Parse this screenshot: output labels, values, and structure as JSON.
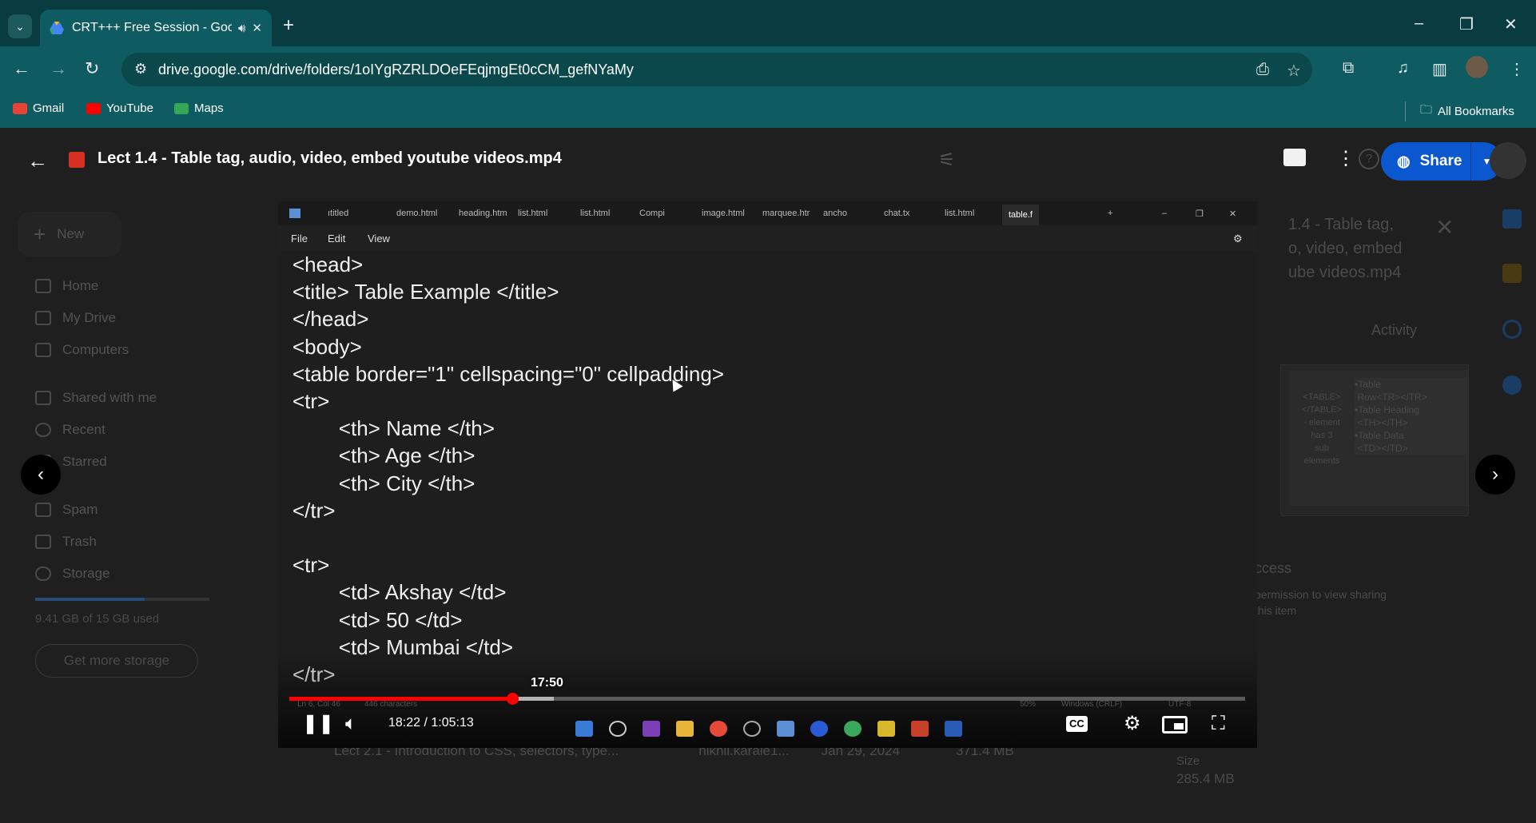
{
  "browser": {
    "tab_title": "CRT+++ Free Session - Goo",
    "tab_audio_icon": "speaker-icon",
    "url": "drive.google.com/drive/folders/1oIYgRZRLDOeFEqjmgEt0cCM_gefNYaMy",
    "bookmarks": [
      {
        "label": "Gmail",
        "color": "#ea4335"
      },
      {
        "label": "YouTube",
        "color": "#ff0000"
      },
      {
        "label": "Maps",
        "color": "#34a853"
      }
    ],
    "all_bookmarks": "All Bookmarks"
  },
  "drive": {
    "new_label": "New",
    "sidebar": [
      {
        "label": "Home"
      },
      {
        "label": "My Drive"
      },
      {
        "label": "Computers"
      },
      {
        "label": "Shared with me"
      },
      {
        "label": "Recent"
      },
      {
        "label": "Starred"
      },
      {
        "label": "Spam"
      },
      {
        "label": "Trash"
      },
      {
        "label": "Storage"
      }
    ],
    "storage_text": "9.41 GB of 15 GB used",
    "storage_fraction": 0.63,
    "get_storage": "Get more storage",
    "bg_row": {
      "name": "Lect 2.1 - Introduction to CSS, selectors, type...",
      "owner": "nikhil.karale1...",
      "date": "Jan 29, 2024",
      "size": "371.4 MB"
    }
  },
  "viewer": {
    "file_title": "Lect 1.4 - Table tag, audio, video, embed youtube videos.mp4",
    "share_label": "Share",
    "details_title": "1.4 - Table tag,\no, video, embed\nube videos.mp4",
    "activity_tab": "Activity",
    "access_heading": "ccess",
    "access_text": "permission to view sharing\nthis item",
    "size_label": "Size",
    "size_value": "285.4 MB",
    "thumb_left": "<TABLE>\n</TABLE>\n- element\nhas 3\nsub\nelements",
    "thumb_right": "•Table\n Row<TR></TR>\n•Table Heading\n <TH></TH>\n•Table Data\n <TD></TD>"
  },
  "video": {
    "editor_tabs": [
      "ıtitled",
      "demo.html",
      "heading.htm",
      "list.html",
      "list.html",
      "Compi",
      "image.html",
      "marquee.htr",
      "ancho",
      "chat.tx",
      "list.html",
      "table.f"
    ],
    "menu": [
      "File",
      "Edit",
      "View"
    ],
    "code_lines": [
      "<head>",
      "<title> Table Example </title>",
      "</head>",
      "<body>",
      "<table border=\"1\" cellspacing=\"0\" cellpadding>",
      "<tr>",
      "        <th> Name </th>",
      "        <th> Age </th>",
      "        <th> City </th>",
      "</tr>",
      "",
      "<tr>",
      "        <td> Akshay </td>",
      "        <td> 50 </td>",
      "        <td> Mumbai </td>",
      "</tr>"
    ],
    "status_items": [
      "Ln 6, Col 46",
      "446 characters",
      "50%",
      "Windows (CRLF)",
      "UTF-8"
    ],
    "hover_time": "17:50",
    "time_display": "18:22 / 1:05:13",
    "played_fraction": 0.233,
    "buffered_fraction": 0.277,
    "hover_fraction": 0.226
  }
}
